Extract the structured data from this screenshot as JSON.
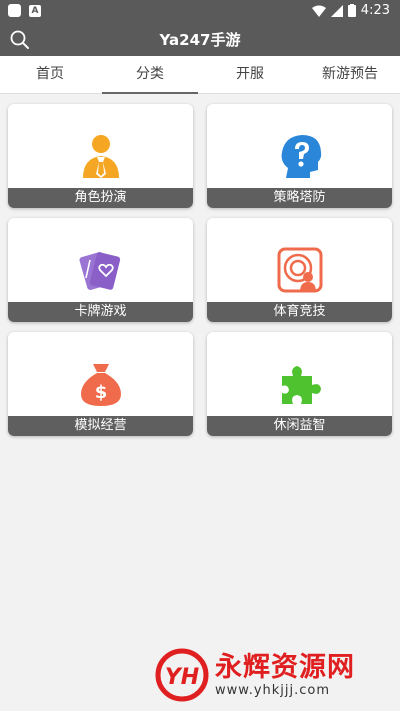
{
  "status_bar": {
    "time": "4:23"
  },
  "header": {
    "title": "Ya247手游"
  },
  "tabs": [
    {
      "label": "首页"
    },
    {
      "label": "分类"
    },
    {
      "label": "开服"
    },
    {
      "label": "新游预告"
    }
  ],
  "categories": [
    {
      "label": "角色扮演",
      "icon": "person-tie-icon",
      "color": "#f5a623"
    },
    {
      "label": "策略塔防",
      "icon": "head-question-icon",
      "color": "#2a86d8"
    },
    {
      "label": "卡牌游戏",
      "icon": "cards-heart-icon",
      "color": "#8a5fc8"
    },
    {
      "label": "体育竞技",
      "icon": "sports-target-icon",
      "color": "#f06b4b"
    },
    {
      "label": "模拟经营",
      "icon": "money-bag-icon",
      "color": "#f06b4b"
    },
    {
      "label": "休闲益智",
      "icon": "puzzle-icon",
      "color": "#4fc230"
    }
  ],
  "watermark": {
    "brand": "永辉资源网",
    "url": "www.yhkjjj.com",
    "logo_text": "YH"
  }
}
